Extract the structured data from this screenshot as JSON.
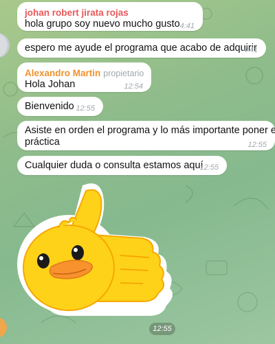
{
  "colors": {
    "bubble_bg": "#ffffff",
    "sender1": "#e8585b",
    "sender2": "#f0912e",
    "time": "#a0a7ad",
    "sticker_yellow": "#ffd21a",
    "sticker_outline": "#ffffff"
  },
  "messages": [
    {
      "sender": "johan robert jirata rojas",
      "text": "hola grupo soy nuevo mucho gusto",
      "time": "4:41"
    },
    {
      "text": "espero me ayude el programa que acabo de adquirir",
      "time": "4:41"
    },
    {
      "sender": "Alexandro Martin",
      "role": "propietario",
      "text": "Hola Johan",
      "time": "12:54"
    },
    {
      "text": "Bienvenido",
      "time": "12:55"
    },
    {
      "text_line1": "Asiste en orden el programa y lo más importante poner en",
      "text_line2": "práctica",
      "time": "12:55"
    },
    {
      "text": "Cualquier duda o consulta estamos aquí",
      "time": "12:55"
    }
  ],
  "sticker": {
    "name": "duck-thumbs-up-sticker",
    "time": "12:55"
  }
}
